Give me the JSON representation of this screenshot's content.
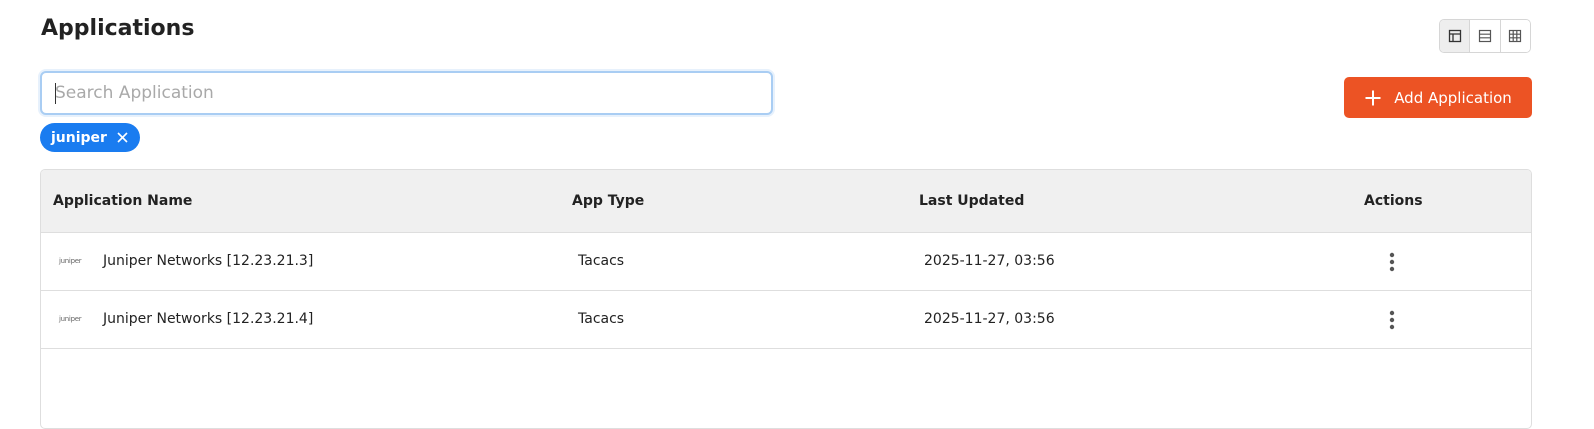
{
  "page": {
    "title": "Applications"
  },
  "view_toggle": {
    "options": [
      {
        "icon": "layout-icon",
        "active": true
      },
      {
        "icon": "list-icon",
        "active": false
      },
      {
        "icon": "grid-icon",
        "active": false
      }
    ]
  },
  "search": {
    "placeholder": "Search Application",
    "value": ""
  },
  "toolbar": {
    "add_label": "Add Application",
    "accent_color": "#ec5324"
  },
  "filters": [
    {
      "label": "juniper",
      "color": "#1a7cf0"
    }
  ],
  "table": {
    "columns": [
      "Application Name",
      "App Type",
      "Last Updated",
      "Actions"
    ],
    "rows": [
      {
        "logo": "juniper",
        "name": "Juniper Networks [12.23.21.3]",
        "type": "Tacacs",
        "updated": "2025-11-27, 03:56"
      },
      {
        "logo": "juniper",
        "name": "Juniper Networks [12.23.21.4]",
        "type": "Tacacs",
        "updated": "2025-11-27, 03:56"
      }
    ]
  }
}
